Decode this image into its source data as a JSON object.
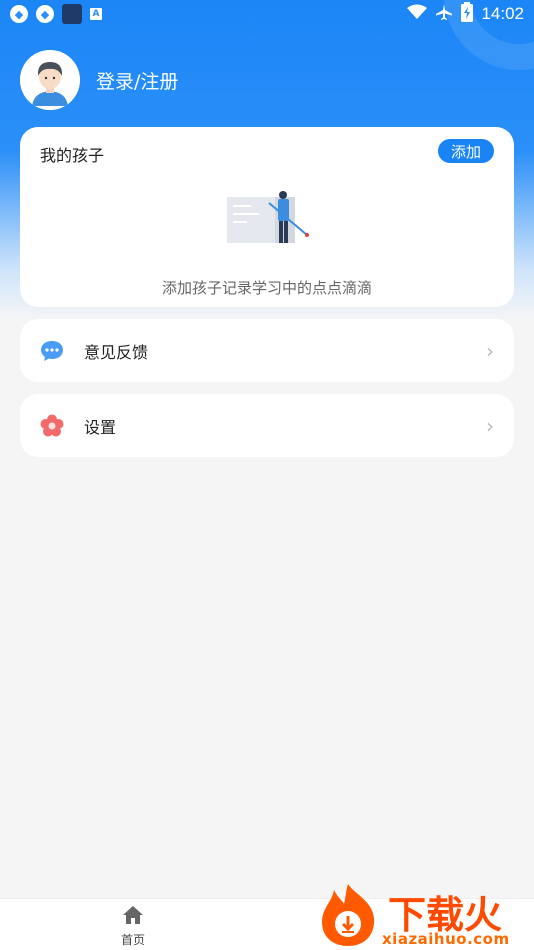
{
  "status_bar": {
    "time": "14:02"
  },
  "header": {
    "login_label": "登录/注册"
  },
  "kids_card": {
    "title": "我的孩子",
    "add_label": "添加",
    "empty_text": "添加孩子记录学习中的点点滴滴"
  },
  "menu": {
    "feedback_label": "意见反馈",
    "settings_label": "设置"
  },
  "bottom_nav": {
    "home_label": "首页"
  },
  "watermark": {
    "title": "下载火",
    "url": "xiazaihuo.com"
  },
  "colors": {
    "primary": "#1a84f5",
    "background": "#f5f5f5",
    "watermark_orange": "#ff5a00"
  }
}
